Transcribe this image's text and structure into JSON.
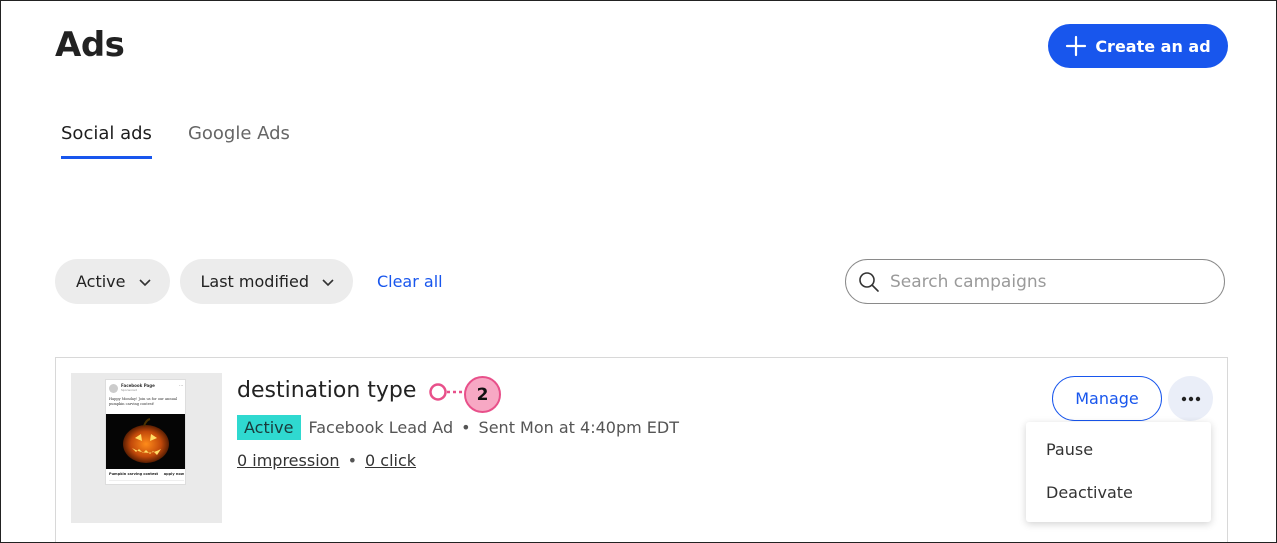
{
  "header": {
    "title": "Ads",
    "create_label": "Create an ad",
    "create_icon": "plus-icon"
  },
  "tabs": [
    {
      "label": "Social ads",
      "active": true
    },
    {
      "label": "Google Ads",
      "active": false
    }
  ],
  "filters": {
    "status_label": "Active",
    "sort_label": "Last modified",
    "clear_label": "Clear all"
  },
  "search": {
    "placeholder": "Search campaigns"
  },
  "campaign": {
    "name": "destination type",
    "callout_number": "2",
    "status": "Active",
    "ad_type": "Facebook Lead Ad",
    "sent": "Sent Mon at 4:40pm EDT",
    "impressions": "0 impression",
    "clicks": "0 click",
    "manage_label": "Manage",
    "thumbnail": {
      "page_name": "Facebook Page",
      "sponsored": "Sponsored",
      "text": "Happy Monday! Join us for our annual pumpkin carving contest!",
      "caption": "Pumpkin carving contest",
      "cta": "apply now"
    }
  },
  "menu": {
    "items": [
      "Pause",
      "Deactivate"
    ]
  },
  "colors": {
    "accent": "#1856ed",
    "status_badge": "#2fd9d0",
    "callout": "#f7a8c4",
    "callout_border": "#e8508a"
  }
}
